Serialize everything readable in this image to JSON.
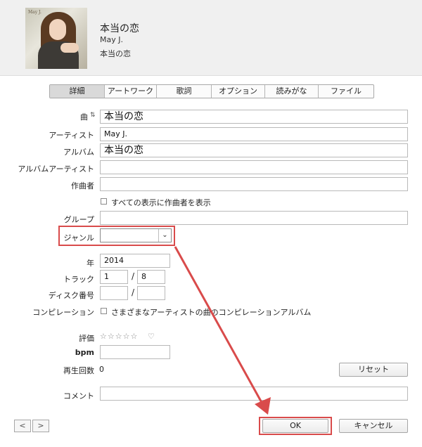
{
  "header": {
    "art_logo": "May J.",
    "title": "本当の恋",
    "artist": "May J.",
    "album": "本当の恋"
  },
  "tabs": [
    {
      "label": "詳細",
      "active": true
    },
    {
      "label": "アートワーク",
      "active": false
    },
    {
      "label": "歌詞",
      "active": false
    },
    {
      "label": "オプション",
      "active": false
    },
    {
      "label": "読みがな",
      "active": false
    },
    {
      "label": "ファイル",
      "active": false
    }
  ],
  "form": {
    "song_label": "曲",
    "song_value": "本当の恋",
    "artist_label": "アーティスト",
    "artist_value": "May J.",
    "album_label": "アルバム",
    "album_value": "本当の恋",
    "album_artist_label": "アルバムアーティスト",
    "album_artist_value": "",
    "composer_label": "作曲者",
    "composer_value": "",
    "show_composer_label": "すべての表示に作曲者を表示",
    "grouping_label": "グループ",
    "grouping_value": "",
    "genre_label": "ジャンル",
    "genre_value": "",
    "year_label": "年",
    "year_value": "2014",
    "track_label": "トラック",
    "track_number": "1",
    "track_total": "8",
    "disc_label": "ディスク番号",
    "disc_number": "",
    "disc_total": "",
    "compilation_label": "コンピレーション",
    "compilation_text": "さまざまなアーティストの曲のコンピレーションアルバム",
    "rating_label": "評価",
    "rating_stars": "☆☆☆☆☆",
    "rating_max": 5,
    "rating_value": 0,
    "heart": "♡",
    "bpm_label": "bpm",
    "bpm_value": "",
    "play_count_label": "再生回数",
    "play_count_value": "0",
    "reset_label": "リセット",
    "comment_label": "コメント",
    "comment_value": ""
  },
  "footer": {
    "prev_glyph": "<",
    "next_glyph": ">",
    "ok_label": "OK",
    "cancel_label": "キャンセル"
  },
  "colors": {
    "highlight": "#d94b4b"
  }
}
